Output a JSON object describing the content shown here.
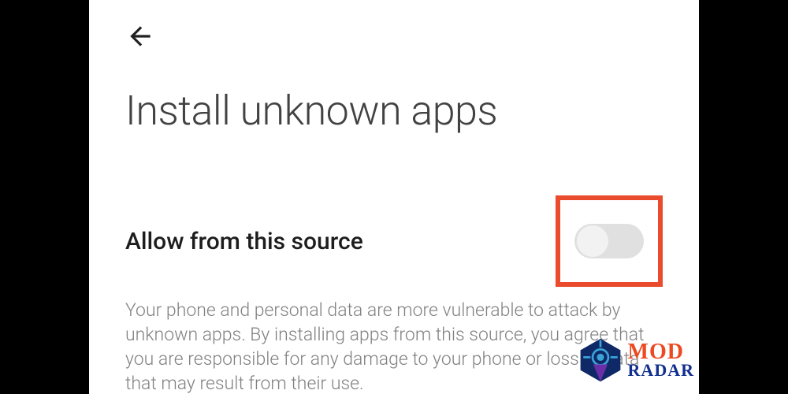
{
  "header": {
    "back_icon": "arrow-left"
  },
  "title": "Install unknown apps",
  "setting": {
    "label": "Allow from this source",
    "toggle_state": "off"
  },
  "description": "Your phone and personal data are more vulnerable to attack by unknown apps. By installing apps from this source, you agree that you are responsible for any damage to your phone or loss of data that may result from their use.",
  "watermark": {
    "line1": "MOD",
    "line2": "RADAR"
  },
  "colors": {
    "highlight": "#eb4b2d",
    "title_text": "#424242",
    "body_text": "#808080",
    "wm_orange": "#ed4a22",
    "wm_blue": "#112f8e"
  }
}
